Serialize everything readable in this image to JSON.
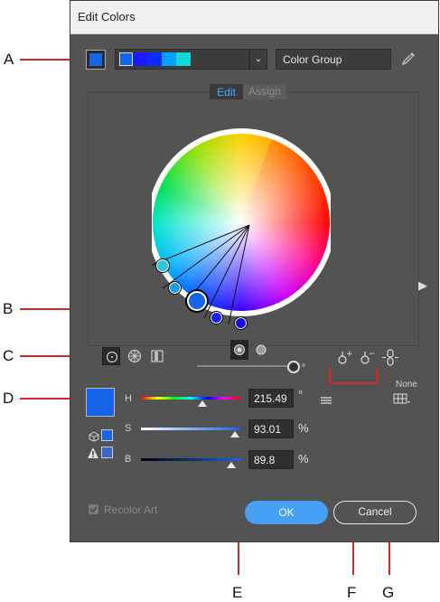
{
  "callouts": [
    "A",
    "B",
    "C",
    "D",
    "E",
    "F",
    "G"
  ],
  "dialog": {
    "title": "Edit Colors"
  },
  "top": {
    "group_name": "Color Group",
    "dropdown_glyph": "⌄"
  },
  "tabs": {
    "edit": "Edit",
    "assign": "Assign"
  },
  "sliders": {
    "h": {
      "label": "H",
      "value": "215.49",
      "unit": "°"
    },
    "s": {
      "label": "S",
      "value": "93.01",
      "unit": "%"
    },
    "b": {
      "label": "B",
      "value": "89.8",
      "unit": "%"
    }
  },
  "none_label": "None",
  "recolor_label": "Recolor Art",
  "buttons": {
    "ok": "OK",
    "cancel": "Cancel"
  },
  "colors": {
    "base": "#1565e8",
    "accent": "#46a0f4",
    "callout": "#d8262c"
  },
  "group_swatches": [
    "#1565e8",
    "#1a1aff",
    "#0a2cff",
    "#0aa0ff",
    "#12d8d8"
  ]
}
